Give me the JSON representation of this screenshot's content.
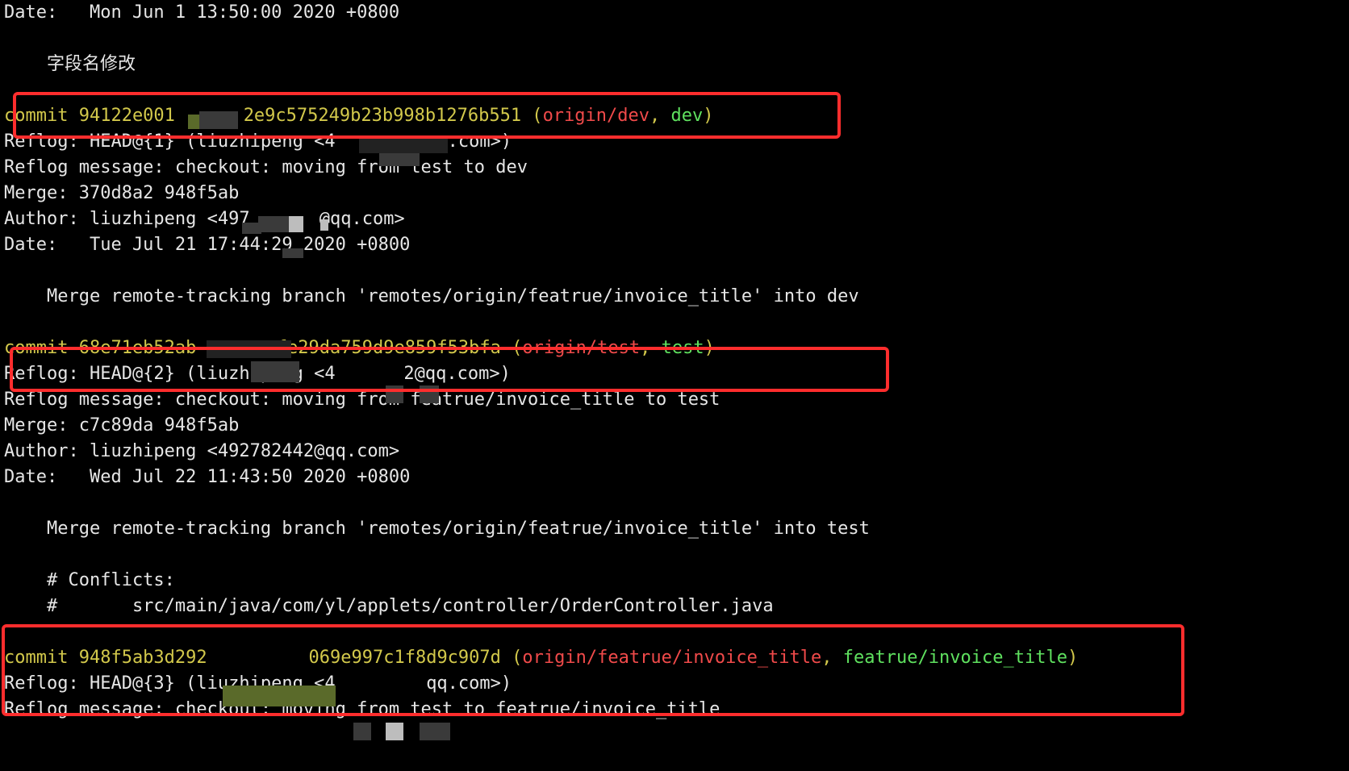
{
  "lines": [
    {
      "text": "Date:   Mon Jun 1 13:50:00 2020 +0800"
    },
    {
      "text": ""
    },
    {
      "text": "    字段名修改"
    },
    {
      "text": ""
    },
    {
      "prefix": "commit 94122e001",
      "hash_end": "2e9c575249b23b998b1276b551",
      "open": " (",
      "remote": "origin/dev",
      "sep": ", ",
      "local": "dev",
      "close": ")"
    },
    {
      "text": "Reflog: HEAD@{1} (liuzhipeng <4",
      "tail": "qq.com>)"
    },
    {
      "text": "Reflog message: checkout: moving from test to dev"
    },
    {
      "text": "Merge: 370d8a2 948f5ab"
    },
    {
      "text": "Author: liuzhipeng <497",
      "tail": "@qq.com>"
    },
    {
      "text": "Date:   Tue Jul 21 17:44:29 2020 +0800"
    },
    {
      "text": ""
    },
    {
      "text": "    Merge remote-tracking branch 'remotes/origin/featrue/invoice_title' into dev"
    },
    {
      "text": ""
    },
    {
      "prefix": "commit 68e71eb52ab",
      "hash_end": "fe29da759d9e859f53bfa",
      "open": " (",
      "remote": "origin/test",
      "sep": ", ",
      "local": "test",
      "close": ")"
    },
    {
      "text": "Reflog: HEAD@{2} (liuzhipeng <4",
      "tail": "2@qq.com>)"
    },
    {
      "text": "Reflog message: checkout: moving from featrue/invoice_title to test"
    },
    {
      "text": "Merge: c7c89da 948f5ab"
    },
    {
      "text": "Author: liuzhipeng <492782442@qq.com>"
    },
    {
      "text": "Date:   Wed Jul 22 11:43:50 2020 +0800"
    },
    {
      "text": ""
    },
    {
      "text": "    Merge remote-tracking branch 'remotes/origin/featrue/invoice_title' into test"
    },
    {
      "text": ""
    },
    {
      "text": "    # Conflicts:"
    },
    {
      "text": "    #       src/main/java/com/yl/applets/controller/OrderController.java"
    },
    {
      "text": ""
    },
    {
      "prefix": "commit 948f5ab3d292",
      "hash_end": "069e997c1f8d9c907d",
      "open": " (",
      "remote": "origin/featrue/invoice_title",
      "sep": ", ",
      "local": "featrue/invoice_title",
      "close": ")"
    },
    {
      "text": "Reflog: HEAD@{3} (liuzhipeng <4",
      "tail": "qq.com>)"
    },
    {
      "text": "Reflog message: checkout: moving from test to featrue/invoice_title"
    }
  ],
  "colors": {
    "background": "#000000",
    "text": "#e6e6e6",
    "commit": "#d2c84b",
    "remote_branch": "#f04a4a",
    "local_branch": "#5fe15f",
    "annotation": "#ff2d2d"
  }
}
